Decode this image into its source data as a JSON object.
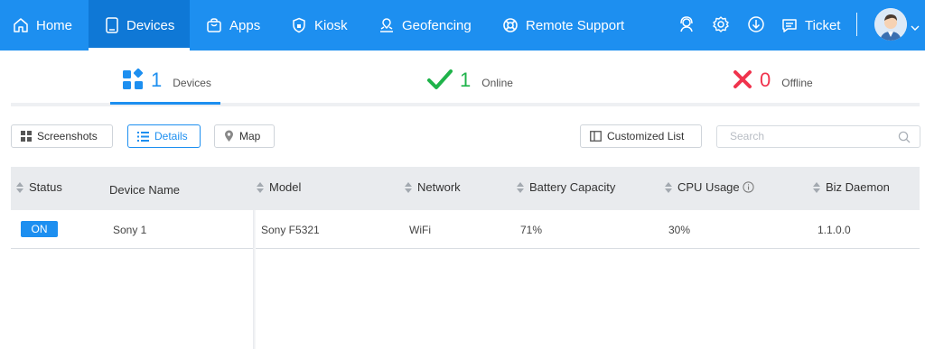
{
  "nav": {
    "items": [
      {
        "label": "Home"
      },
      {
        "label": "Devices"
      },
      {
        "label": "Apps"
      },
      {
        "label": "Kiosk"
      },
      {
        "label": "Geofencing"
      },
      {
        "label": "Remote Support"
      }
    ],
    "active": "Devices",
    "ticket_label": "Ticket",
    "icons": [
      "headset-icon",
      "gear-icon",
      "download-icon",
      "chat-icon",
      "avatar",
      "chevron-down-icon"
    ]
  },
  "stats": {
    "devices": {
      "count": "1",
      "label": "Devices"
    },
    "online": {
      "count": "1",
      "label": "Online"
    },
    "offline": {
      "count": "0",
      "label": "Offline"
    }
  },
  "toolbar": {
    "screenshots": "Screenshots",
    "details": "Details",
    "map": "Map",
    "customized_list": "Customized List",
    "search_placeholder": "Search"
  },
  "table": {
    "headers": [
      "Status",
      "Device Name",
      "Model",
      "Network",
      "Battery Capacity",
      "CPU Usage",
      "Biz Daemon"
    ],
    "rows": [
      {
        "status": "ON",
        "device_name": "Sony 1",
        "model": "Sony F5321",
        "network": "WiFi",
        "battery": "71%",
        "cpu": "30%",
        "biz_daemon": "1.1.0.0"
      }
    ]
  },
  "colors": {
    "brand": "#1d8ff0",
    "online": "#1fb34a",
    "offline": "#f0334d"
  }
}
